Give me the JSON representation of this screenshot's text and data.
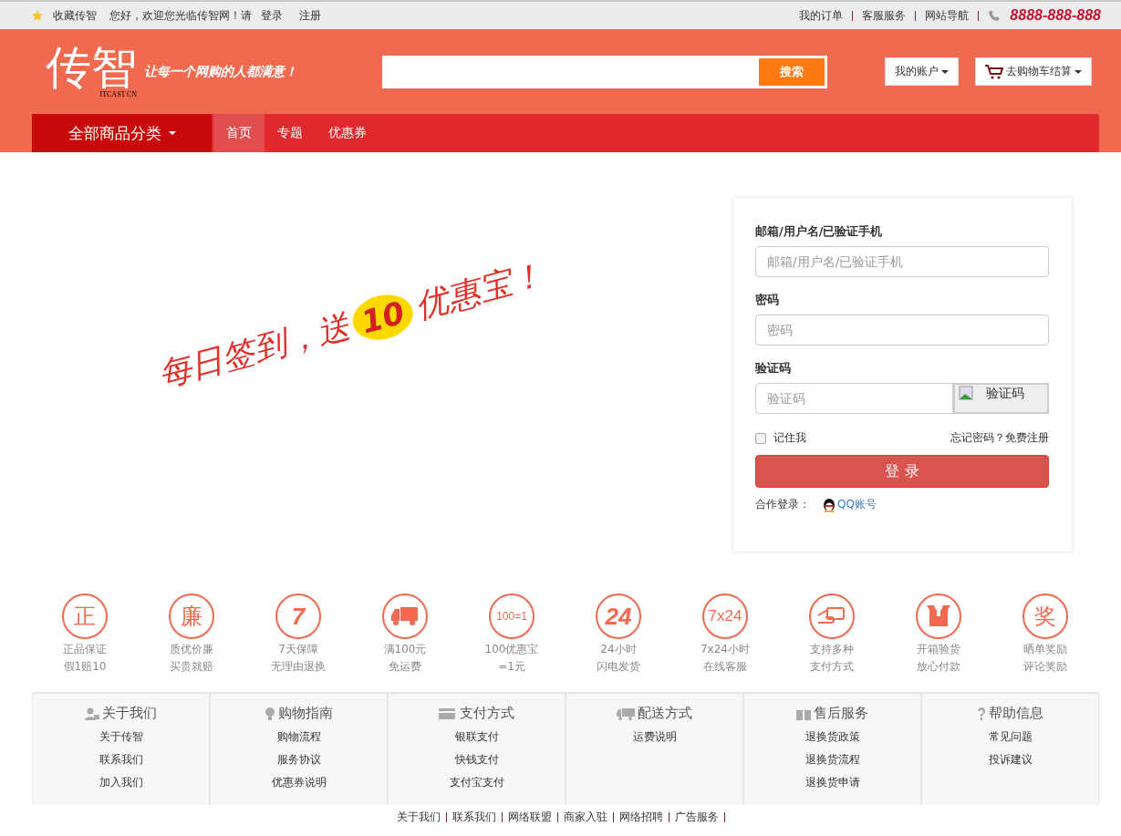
{
  "topbar": {
    "favorite": "收藏传智",
    "welcome": "您好，欢迎您光临传智网！请",
    "login": "登录",
    "register": "注册",
    "links": [
      "我的订单",
      "客服服务",
      "网站导航"
    ],
    "phone": "8888-888-888"
  },
  "header": {
    "logo": "传智",
    "logo_sub": "ITCAST.CN",
    "slogan": "让每一个网购的人都满意！",
    "search_button": "搜索",
    "account": "我的账户",
    "cart": "去购物车结算"
  },
  "nav": {
    "category": "全部商品分类",
    "items": [
      {
        "label": "首页",
        "selected": true
      },
      {
        "label": "专题",
        "selected": false
      },
      {
        "label": "优惠券",
        "selected": false
      }
    ]
  },
  "banner": {
    "line": "每日签到，送",
    "badge": "10",
    "tail": "优惠宝！"
  },
  "login": {
    "fields": [
      {
        "kind": "text",
        "label": "邮箱/用户名/已验证手机",
        "placeholder": "邮箱/用户名/已验证手机"
      },
      {
        "kind": "password",
        "label": "密码",
        "placeholder": "密码"
      },
      {
        "kind": "captcha",
        "label": "验证码",
        "placeholder": "验证码",
        "captcha_alt": "验证码"
      }
    ],
    "remember": {
      "label": "记住我",
      "checked": false
    },
    "forgot": "忘记密码？",
    "signup": "免费注册",
    "submit": "登 录",
    "partner_label": "合作登录：",
    "partner": "QQ账号"
  },
  "features": [
    {
      "kind": "text",
      "glyph": "正",
      "lines": [
        "正品保证",
        "假1赔10"
      ]
    },
    {
      "kind": "text",
      "glyph": "廉",
      "lines": [
        "质优价廉",
        "买贵就赔"
      ]
    },
    {
      "kind": "bold",
      "glyph": "7",
      "lines": [
        "7天保障",
        "无理由退换"
      ]
    },
    {
      "kind": "truck",
      "lines": [
        "满100元",
        "免运费"
      ]
    },
    {
      "kind": "small",
      "glyph": "100=1",
      "lines": [
        "100优惠宝",
        "=1元"
      ]
    },
    {
      "kind": "bold",
      "glyph": "24",
      "lines": [
        "24小时",
        "闪电发货"
      ]
    },
    {
      "kind": "medium",
      "glyph": "7x24",
      "lines": [
        "7x24小时",
        "在线客服"
      ]
    },
    {
      "kind": "card",
      "lines": [
        "支持多种",
        "支付方式"
      ]
    },
    {
      "kind": "box",
      "lines": [
        "开箱验货",
        "放心付款"
      ]
    },
    {
      "kind": "text",
      "glyph": "奖",
      "lines": [
        "晒单奖励",
        "评论奖励"
      ]
    }
  ],
  "footer_columns": [
    {
      "kind": "user",
      "title": "关于我们",
      "links": [
        "关于传智",
        "联系我们",
        "加入我们"
      ]
    },
    {
      "kind": "bulb",
      "title": "购物指南",
      "links": [
        "购物流程",
        "服务协议",
        "优惠券说明"
      ]
    },
    {
      "kind": "card",
      "title": "支付方式",
      "links": [
        "银联支付",
        "快钱支付",
        "支付宝支付"
      ]
    },
    {
      "kind": "truck",
      "title": "配送方式",
      "links": [
        "运费说明"
      ]
    },
    {
      "kind": "gift",
      "title": "售后服务",
      "links": [
        "退换货政策",
        "退换货流程",
        "退换货申请"
      ]
    },
    {
      "kind": "help",
      "title": "帮助信息",
      "links": [
        "常见问题",
        "投诉建议"
      ]
    }
  ],
  "bottom_links": [
    "关于我们",
    "联系我们",
    "网络联盟",
    "商家入驻",
    "网络招聘",
    "广告服务"
  ]
}
